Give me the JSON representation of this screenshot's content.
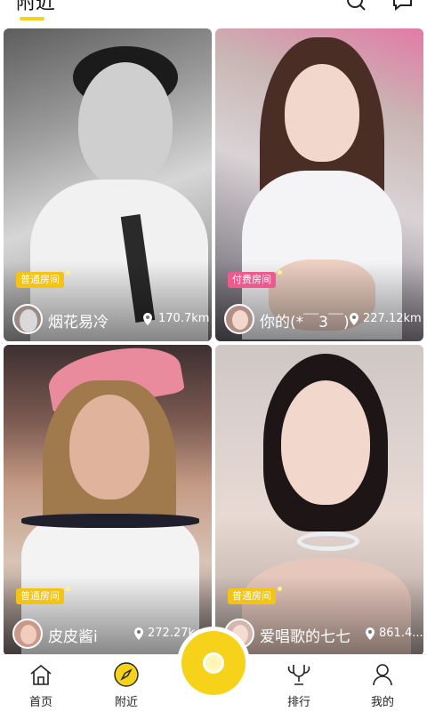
{
  "header": {
    "active_tab": "附近",
    "icons": [
      "search-icon",
      "message-icon"
    ]
  },
  "cards": [
    {
      "room_tag": "普通房间",
      "room_type": "normal",
      "name": "烟花易冷",
      "distance": "170.7km"
    },
    {
      "room_tag": "付费房间",
      "room_type": "paid",
      "name": "你的(*￣3￣)",
      "distance": "227.12km"
    },
    {
      "room_tag": "普通房间",
      "room_type": "normal",
      "name": "皮皮酱i",
      "distance": "272.27k"
    },
    {
      "room_tag": "普通房间",
      "room_type": "normal",
      "name": "爱唱歌的七七",
      "distance": "861.4..."
    }
  ],
  "nav": {
    "home": "首页",
    "nearby": "附近",
    "rank": "排行",
    "mine": "我的"
  },
  "colors": {
    "accent": "#f7d21a",
    "tag_normal": "#f3c316",
    "tag_paid": "#ec5a8e"
  }
}
